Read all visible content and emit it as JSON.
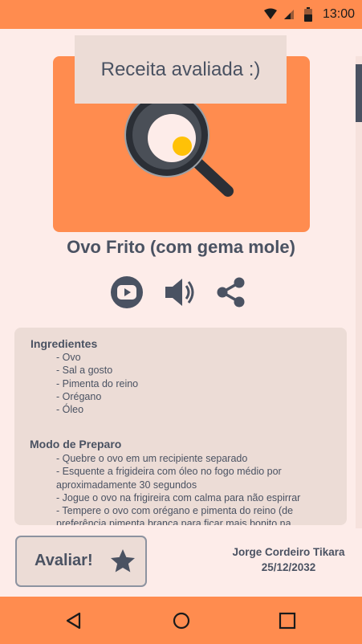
{
  "status_bar": {
    "time": "13:00",
    "icons": [
      "wifi-icon",
      "signal-icon",
      "battery-icon"
    ]
  },
  "toast": {
    "message": "Receita avaliada :)"
  },
  "recipe": {
    "title": "Ovo Frito (com gema mole)",
    "image_icon": "frying-pan-egg-illustration",
    "actions": [
      "youtube-icon",
      "volume-icon",
      "share-icon"
    ],
    "ingredients_title": "Ingredientes",
    "ingredients": [
      "- Ovo",
      "- Sal a gosto",
      "- Pimenta do reino",
      "- Orégano",
      "- Óleo"
    ],
    "steps_title": "Modo de Preparo",
    "steps": [
      "- Quebre o ovo em um recipiente separado",
      "- Esquente a frigideira com óleo no fogo médio por aproximadamente 30 segundos",
      "- Jogue o ovo na frigireira com calma para não espirrar",
      "- Tempere o ovo com orégano e pimenta do reino (de preferência pimenta branca para ficar mais bonito na"
    ]
  },
  "rate_button": {
    "label": "Avaliar!",
    "icon": "star-icon"
  },
  "author": {
    "name": "Jorge Cordeiro Tikara",
    "date": "25/12/2032"
  },
  "nav_bar": {
    "icons": [
      "back-icon",
      "home-icon",
      "recents-icon"
    ]
  },
  "colors": {
    "accent": "#ff8c4f",
    "background": "#fdece9",
    "card": "#ecdcd6",
    "text": "#4a5262",
    "yolk": "#ffc107"
  }
}
